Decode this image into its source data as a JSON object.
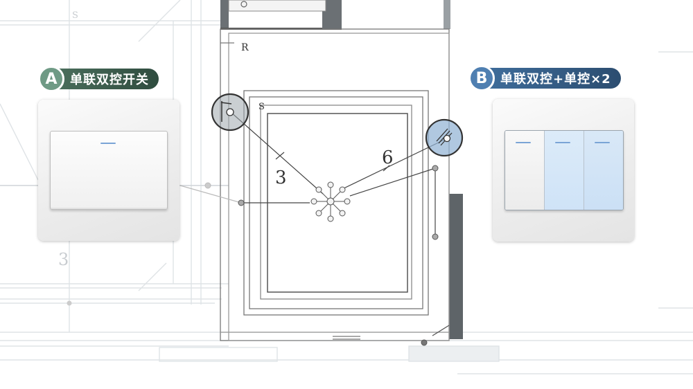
{
  "labels": {
    "a": {
      "letter": "A",
      "text": "单联双控开关"
    },
    "b": {
      "letter": "B",
      "text": "单联双控+单控×2"
    }
  },
  "plan": {
    "room_mark_outer": "R",
    "room_mark_inner": "S",
    "room_mark_top_left": "S",
    "wire_count_left": "3",
    "wire_count_right": "6",
    "wire_count_far_left": "3"
  },
  "colors": {
    "label_a": "#4a6e5c",
    "label_b": "#3e6c9a",
    "switch_b_keys": "#cfe3f7",
    "highlight_b": "#8fb0d3"
  }
}
